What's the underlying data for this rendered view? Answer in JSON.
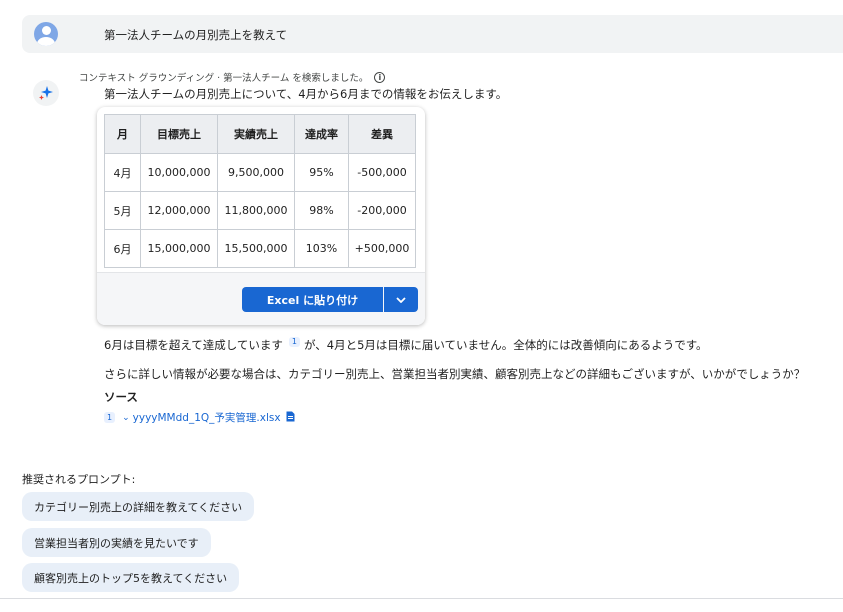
{
  "user_message": {
    "text": "第一法人チームの月別売上を教えて"
  },
  "response": {
    "grounding_note": "コンテキスト グラウンディング · 第一法人チーム を検索しました。",
    "intro": "第一法人チームの月別売上について、4月から6月までの情報をお伝えします。",
    "table": {
      "headers": [
        "月",
        "目標売上",
        "実績売上",
        "達成率",
        "差異"
      ],
      "rows": [
        [
          "4月",
          "10,000,000",
          "9,500,000",
          "95%",
          "-500,000"
        ],
        [
          "5月",
          "12,000,000",
          "11,800,000",
          "98%",
          "-200,000"
        ],
        [
          "6月",
          "15,000,000",
          "15,500,000",
          "103%",
          "+500,000"
        ]
      ],
      "excel_button_label": "Excel に貼り付け"
    },
    "paragraph1_before": "6月は目標を超えて達成しています",
    "citation": "1",
    "paragraph1_after": "が、4月と5月は目標に届いていません。全体的には改善傾向にあるようです。",
    "paragraph2": "さらに詳しい情報が必要な場合は、カテゴリー別売上、営業担当者別実績、顧客別売上などの詳細もございますが、いかがでしょうか？",
    "sources_title": "ソース",
    "source": {
      "number": "1",
      "file": "yyyyMMdd_1Q_予実管理.xlsx"
    }
  },
  "suggestions": {
    "title": "推奨されるプロンプト:",
    "items": [
      "カテゴリー別売上の詳細を教えてください",
      "営業担当者別の実績を見たいです",
      "顧客別売上のトップ5を教えてください"
    ]
  },
  "icons": {
    "avatar": "user-avatar-icon",
    "assistant": "sparkle-icon",
    "info": "info-icon",
    "dropdown": "chevron-down-icon",
    "file": "file-icon"
  },
  "colors": {
    "accent": "#1967d2",
    "chip_bg": "#e8eff8",
    "user_bar_bg": "#f1f3f4"
  }
}
